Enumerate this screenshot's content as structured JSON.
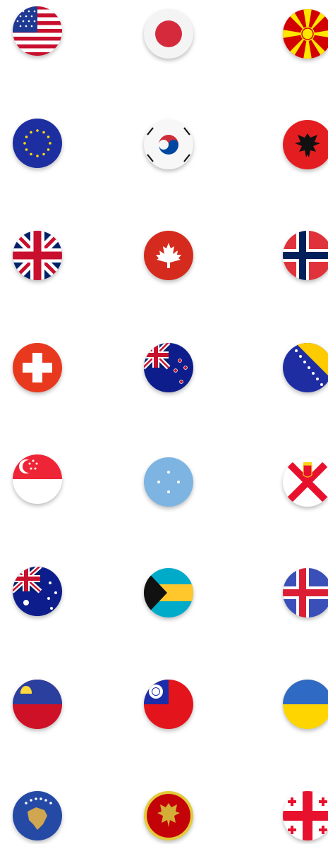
{
  "flags": [
    {
      "icon": "usa-flag-icon"
    },
    {
      "icon": "japan-flag-icon"
    },
    {
      "icon": "north-macedonia-flag-icon"
    },
    {
      "icon": "european-union-flag-icon"
    },
    {
      "icon": "south-korea-flag-icon"
    },
    {
      "icon": "albania-flag-icon"
    },
    {
      "icon": "united-kingdom-flag-icon"
    },
    {
      "icon": "canada-flag-icon"
    },
    {
      "icon": "norway-flag-icon"
    },
    {
      "icon": "switzerland-flag-icon"
    },
    {
      "icon": "new-zealand-flag-icon"
    },
    {
      "icon": "bosnia-herzegovina-flag-icon"
    },
    {
      "icon": "singapore-flag-icon"
    },
    {
      "icon": "micronesia-flag-icon"
    },
    {
      "icon": "jersey-flag-icon"
    },
    {
      "icon": "australia-flag-icon"
    },
    {
      "icon": "bahamas-flag-icon"
    },
    {
      "icon": "iceland-flag-icon"
    },
    {
      "icon": "liechtenstein-flag-icon"
    },
    {
      "icon": "taiwan-flag-icon"
    },
    {
      "icon": "ukraine-flag-icon"
    },
    {
      "icon": "kosovo-flag-icon"
    },
    {
      "icon": "montenegro-flag-icon"
    },
    {
      "icon": "georgia-flag-icon"
    }
  ]
}
